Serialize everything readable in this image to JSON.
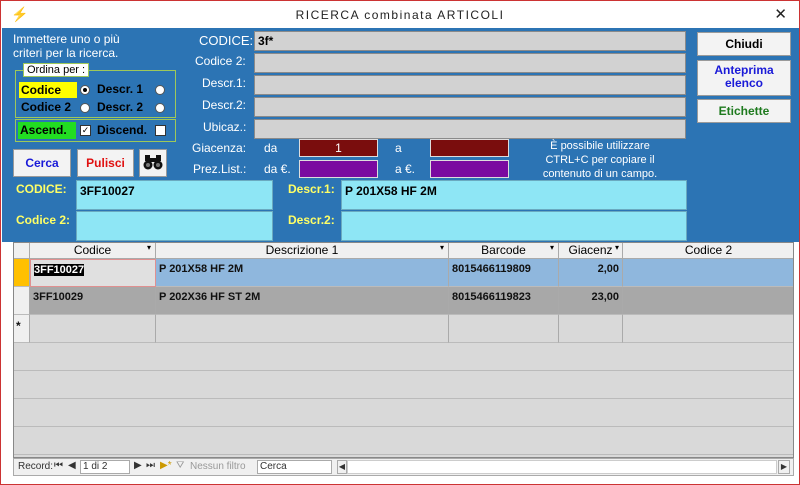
{
  "window": {
    "title": "RICERCA combinata ARTICOLI",
    "close_glyph": "✕",
    "app_icon": "⚡"
  },
  "intro_text_1": "Immettere uno o più",
  "intro_text_2": "criteri per la ricerca.",
  "order": {
    "legend": "Ordina per :",
    "codice_label": "Codice",
    "codice2_label": "Codice 2",
    "descr1_label": "Descr. 1",
    "descr2_label": "Descr. 2",
    "asc_label": "Ascend.",
    "desc_label": "Discend."
  },
  "search": {
    "codice_label": "CODICE:",
    "codice_value": "3f*",
    "codice2_label": "Codice 2:",
    "descr1_label": "Descr.1:",
    "descr2_label": "Descr.2:",
    "ubicaz_label": "Ubicaz.:",
    "giacenza_label": "Giacenza:",
    "da_label": "da",
    "a_label": "a",
    "giacenza_from": "1",
    "prezlist_label": "Prez.List.:",
    "da_euro_label": "da €.",
    "a_euro_label": "a €.",
    "hint_1": "È possibile utilizzare",
    "hint_2": "CTRL+C per copiare il",
    "hint_3": "contenuto di un campo."
  },
  "buttons": {
    "chiudi": "Chiudi",
    "anteprima_1": "Anteprima",
    "anteprima_2": "elenco",
    "etichette": "Etichette",
    "cerca": "Cerca",
    "pulisci": "Pulisci"
  },
  "detail": {
    "codice_label": "CODICE:",
    "codice_value": "3FF10027",
    "codice2_label": "Codice 2:",
    "codice2_value": "",
    "descr1_label": "Descr.1:",
    "descr1_value": "P 201X58 HF 2M",
    "descr2_label": "Descr.2:",
    "descr2_value": ""
  },
  "grid": {
    "headers": [
      "Codice",
      "Descrizione 1",
      "Barcode",
      "Giacenz",
      "Codice 2"
    ],
    "rows": [
      {
        "codice": "3FF10027",
        "descr": "P 201X58 HF 2M",
        "barcode": "8015466119809",
        "giacenza": "2,00",
        "codice2": ""
      },
      {
        "codice": "3FF10029",
        "descr": "P 202X36 HF ST 2M",
        "barcode": "8015466119823",
        "giacenza": "23,00",
        "codice2": ""
      }
    ],
    "new_row_marker": "*"
  },
  "navbar": {
    "record_label": "Record:",
    "position": "1 di 2",
    "filter_label": "Nessun filtro",
    "search_placeholder": "Cerca"
  },
  "colors": {
    "panel_bg": "#2c74b4",
    "label_yellow": "#ffff66",
    "detail_bg": "#8ee6f5",
    "giacenza_bg": "#7a0d0d",
    "prezzo_bg": "#7a0aa0",
    "selected_row": "#8fb7dd",
    "grey_row": "#a8a8a8"
  }
}
